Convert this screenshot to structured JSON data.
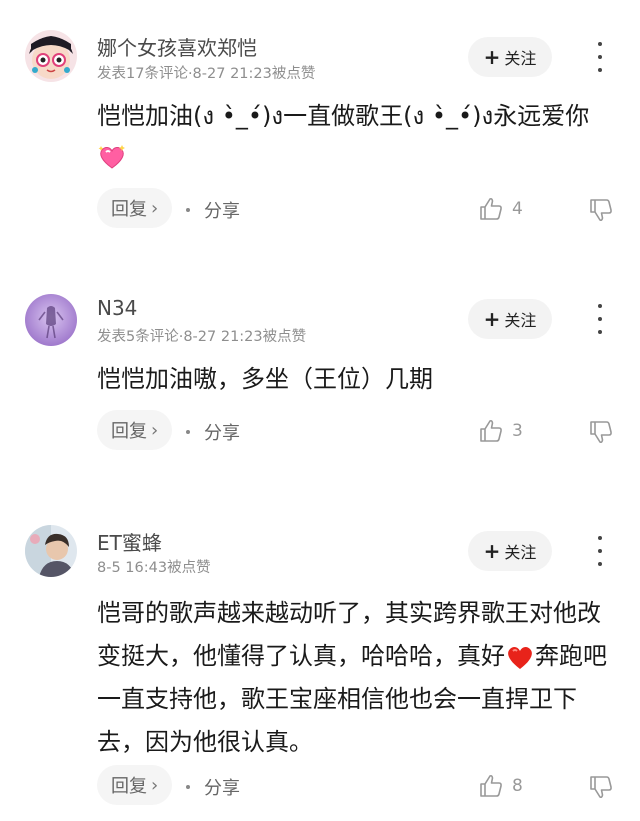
{
  "comments": [
    {
      "username": "娜个女孩喜欢郑恺",
      "meta": "发表17条评论·8-27 21:23被点赞",
      "follow_label": "关注",
      "text": "恺恺加油(ง •̀_•́)ง一直做歌王(ง •̀_•́)ง永远爱你",
      "emoji": "sparkling-heart",
      "reply_label": "回复",
      "share_label": "分享",
      "likes": "4"
    },
    {
      "username": "N34",
      "meta": "发表5条评论·8-27 21:23被点赞",
      "follow_label": "关注",
      "text": "恺恺加油嗷，多坐（王位）几期",
      "reply_label": "回复",
      "share_label": "分享",
      "likes": "3"
    },
    {
      "username": "ET蜜蜂",
      "meta": "8-5 16:43被点赞",
      "follow_label": "关注",
      "text": "恺哥的歌声越来越动听了，其实跨界歌王对他改变挺大，他懂得了认真，哈哈哈，真好",
      "text_after_emoji": "奔跑吧一直支持他，歌王宝座相信他也会一直捍卫下去，因为他很认真。",
      "emoji": "red-heart",
      "reply_label": "回复",
      "share_label": "分享",
      "likes": "8"
    }
  ],
  "icons": {
    "follow": "plus-icon",
    "more": "more-vertical-icon",
    "reply_arrow": "chevron-right-icon",
    "like": "thumbs-up-icon",
    "dislike": "thumbs-down-icon"
  },
  "colors": {
    "background": "#ffffff",
    "meta_text": "#8e8e8e",
    "button_bg": "#f3f3f3",
    "sparkling_heart": "#ff5fa2",
    "red_heart": "#e8231a"
  }
}
